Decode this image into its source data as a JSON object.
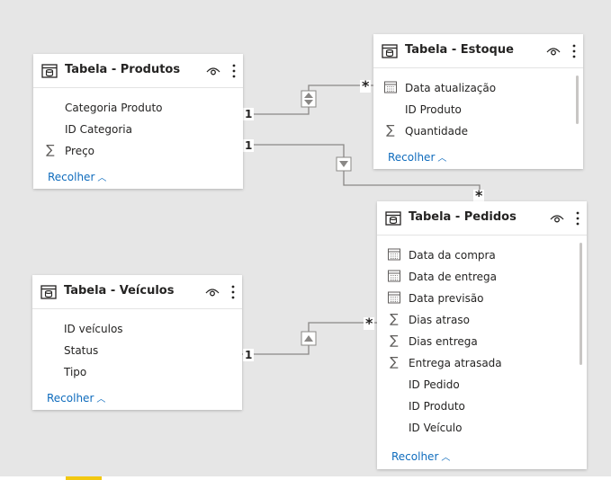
{
  "tables": {
    "produtos": {
      "title": "Tabela - Produtos",
      "fields": [
        {
          "label": "Categoria Produto",
          "icon": ""
        },
        {
          "label": "ID Categoria",
          "icon": ""
        },
        {
          "label": "Preço",
          "icon": "∑"
        }
      ],
      "collapse_label": "Recolher"
    },
    "estoque": {
      "title": "Tabela - Estoque",
      "fields": [
        {
          "label": "Data atualização",
          "icon": "calendar-icon"
        },
        {
          "label": "ID Produto",
          "icon": ""
        },
        {
          "label": "Quantidade",
          "icon": "∑"
        }
      ],
      "collapse_label": "Recolher"
    },
    "pedidos": {
      "title": "Tabela - Pedidos",
      "fields": [
        {
          "label": "Data da compra",
          "icon": "calendar-icon"
        },
        {
          "label": "Data de entrega",
          "icon": "calendar-icon"
        },
        {
          "label": "Data previsão",
          "icon": "calendar-icon"
        },
        {
          "label": "Dias atraso",
          "icon": "∑"
        },
        {
          "label": "Dias entrega",
          "icon": "∑"
        },
        {
          "label": "Entrega atrasada",
          "icon": "∑"
        },
        {
          "label": "ID Pedido",
          "icon": ""
        },
        {
          "label": "ID Produto",
          "icon": ""
        },
        {
          "label": "ID Veículo",
          "icon": ""
        }
      ],
      "collapse_label": "Recolher"
    },
    "veiculos": {
      "title": "Tabela - Veículos",
      "fields": [
        {
          "label": "ID veículos",
          "icon": ""
        },
        {
          "label": "Status",
          "icon": ""
        },
        {
          "label": "Tipo",
          "icon": ""
        }
      ],
      "collapse_label": "Recolher"
    }
  },
  "relationships": {
    "produtos_estoque": {
      "from_label": "1",
      "to_label": "*",
      "direction": "both"
    },
    "produtos_pedidos": {
      "from_label": "1",
      "to_label": "*",
      "direction": "down"
    },
    "veiculos_pedidos": {
      "from_label": "1",
      "to_label": "*",
      "direction": "up"
    }
  },
  "colors": {
    "canvas": "#e6e6e6",
    "card": "#ffffff",
    "link": "#0f6cbd",
    "line": "#8a8886",
    "accent_tab": "#f2c811"
  }
}
